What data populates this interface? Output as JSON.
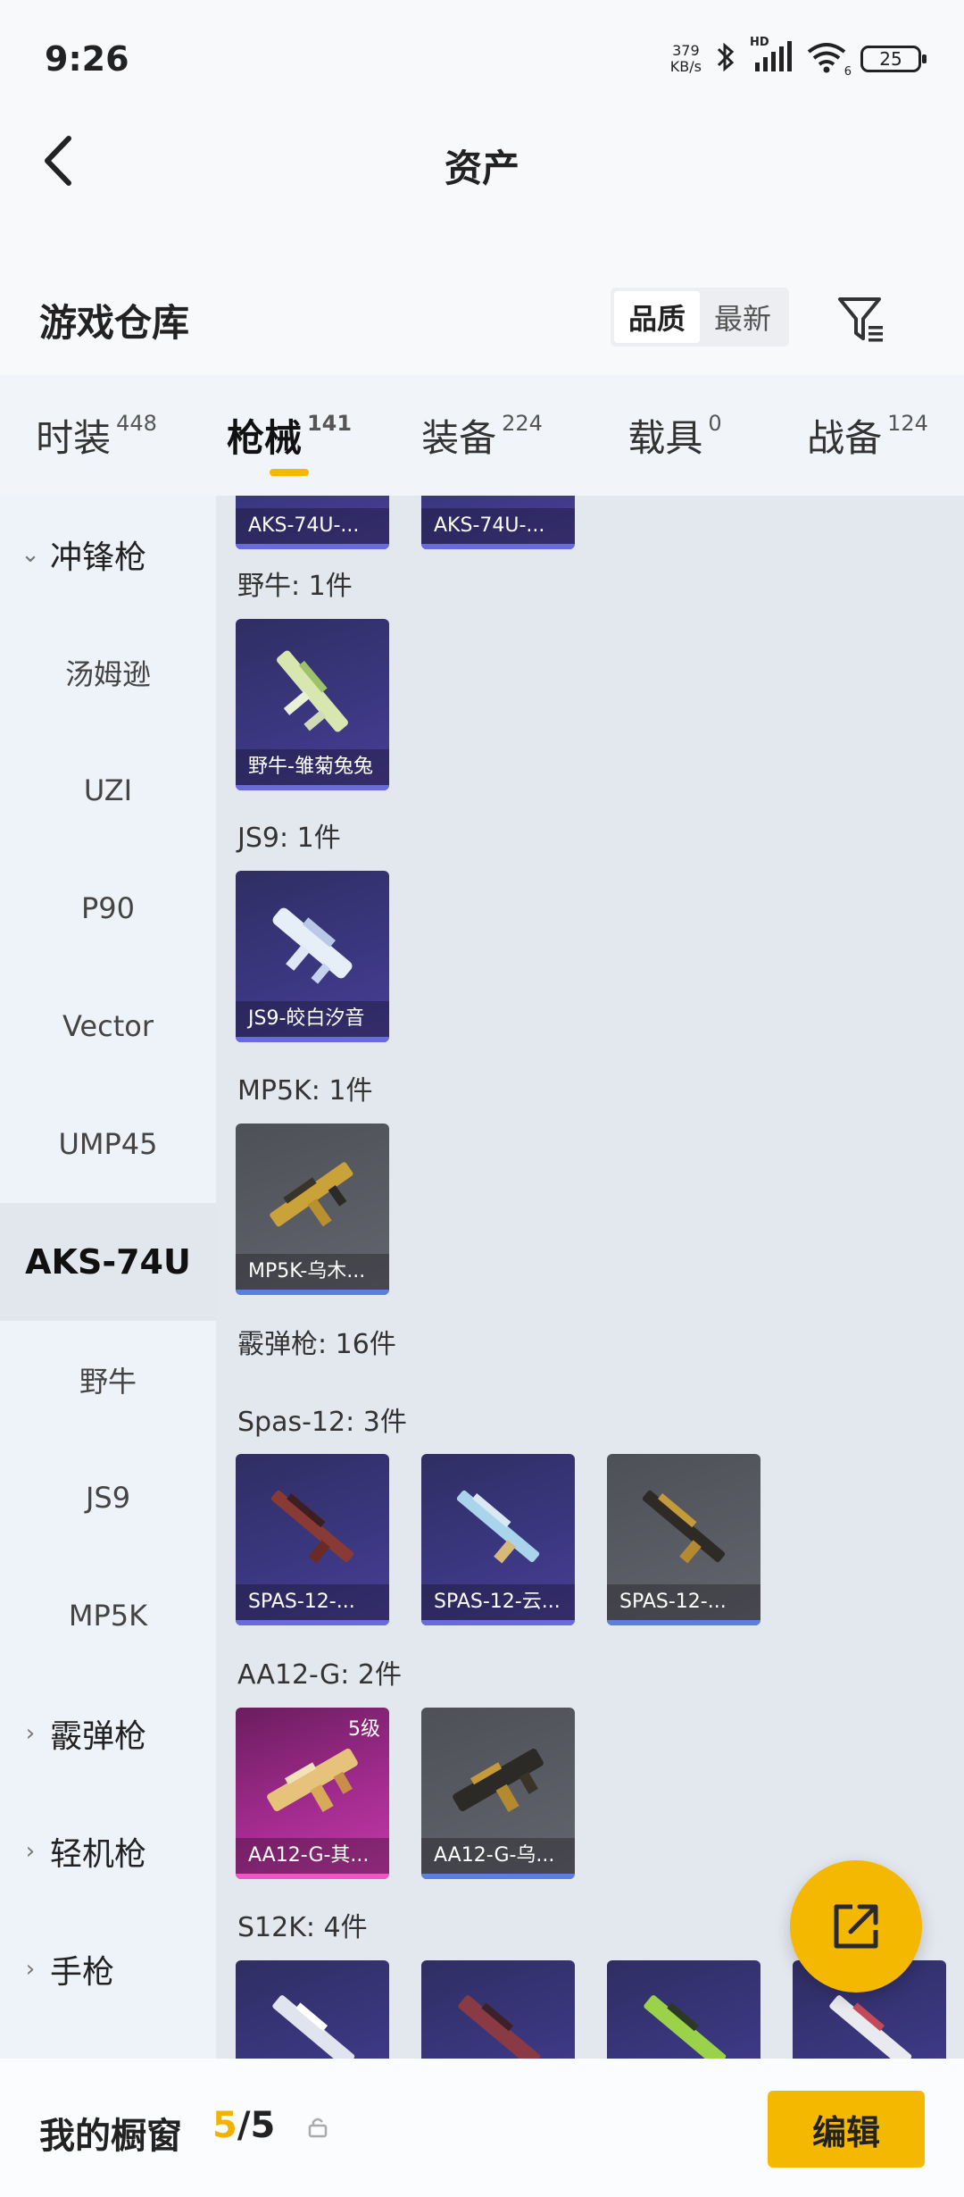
{
  "status": {
    "time": "9:26",
    "net_speed_value": "379",
    "net_speed_unit": "KB/s",
    "hd_label": "HD",
    "wifi_sub": "6",
    "battery": "25"
  },
  "header": {
    "title": "资产"
  },
  "warehouse": {
    "title": "游戏仓库",
    "sort_options": [
      "品质",
      "最新"
    ]
  },
  "tabs": [
    {
      "label": "时装",
      "count": "448"
    },
    {
      "label": "枪械",
      "count": "141"
    },
    {
      "label": "装备",
      "count": "224"
    },
    {
      "label": "载具",
      "count": "0"
    },
    {
      "label": "战备",
      "count": "124"
    }
  ],
  "sidenav": {
    "items": [
      {
        "label": "冲锋枪",
        "type": "group-open"
      },
      {
        "label": "汤姆逊",
        "type": "item"
      },
      {
        "label": "UZI",
        "type": "item"
      },
      {
        "label": "P90",
        "type": "item"
      },
      {
        "label": "Vector",
        "type": "item"
      },
      {
        "label": "UMP45",
        "type": "item"
      },
      {
        "label": "AKS-74U",
        "type": "item-active"
      },
      {
        "label": "野牛",
        "type": "item"
      },
      {
        "label": "JS9",
        "type": "item"
      },
      {
        "label": "MP5K",
        "type": "item"
      },
      {
        "label": "霰弹枪",
        "type": "group"
      },
      {
        "label": "轻机枪",
        "type": "group"
      },
      {
        "label": "手枪",
        "type": "group"
      }
    ]
  },
  "sections": {
    "aks_cards": [
      "AKS-74U-...",
      "AKS-74U-..."
    ],
    "bison_label": "野牛: 1件",
    "bison_cards": [
      "野牛-雏菊兔兔"
    ],
    "js9_label": "JS9: 1件",
    "js9_cards": [
      "JS9-皎白汐音"
    ],
    "mp5k_label": "MP5K: 1件",
    "mp5k_cards": [
      "MP5K-乌木..."
    ],
    "shotgun_label": "霰弹枪: 16件",
    "spas_label": "Spas-12: 3件",
    "spas_cards": [
      "SPAS-12-...",
      "SPAS-12-云...",
      "SPAS-12-..."
    ],
    "aa12_label": "AA12-G: 2件",
    "aa12_cards": [
      "AA12-G-其...",
      "AA12-G-乌..."
    ],
    "aa12_badge": "5级",
    "s12k_label": "S12K: 4件"
  },
  "bottom": {
    "showcase_label": "我的橱窗",
    "showcase_current": "5",
    "showcase_sep_total": "/5",
    "edit_label": "编辑"
  },
  "colors": {
    "accent": "#f5b800",
    "card_purple": "#3a3780",
    "card_gray": "#5b5d66",
    "card_pink": "#a22b8e"
  }
}
